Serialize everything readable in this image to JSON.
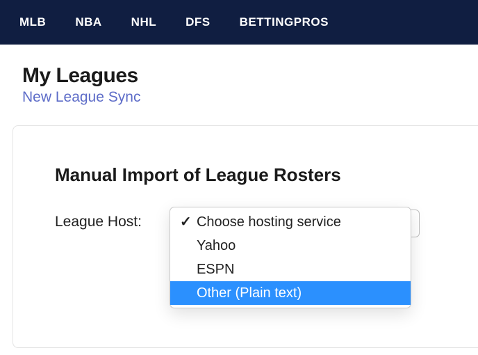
{
  "nav": {
    "items": [
      {
        "label": "MLB"
      },
      {
        "label": "NBA"
      },
      {
        "label": "NHL"
      },
      {
        "label": "DFS"
      },
      {
        "label": "BETTINGPROS"
      }
    ]
  },
  "header": {
    "title": "My Leagues",
    "subtitle": "New League Sync"
  },
  "card": {
    "title": "Manual Import of League Rosters",
    "field_label": "League Host:"
  },
  "dropdown": {
    "options": [
      {
        "label": "Choose hosting service",
        "selected": true
      },
      {
        "label": "Yahoo",
        "selected": false
      },
      {
        "label": "ESPN",
        "selected": false
      },
      {
        "label": "Other (Plain text)",
        "selected": false,
        "highlighted": true
      }
    ]
  }
}
